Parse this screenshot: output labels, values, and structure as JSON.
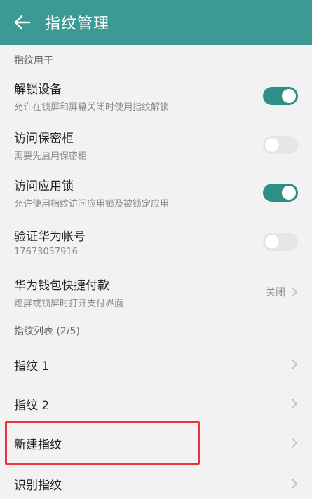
{
  "header": {
    "title": "指纹管理",
    "icon": "back-arrow-icon"
  },
  "sections": {
    "usage": "指纹用于",
    "list": "指纹列表 (2/5)"
  },
  "settings": [
    {
      "title": "解锁设备",
      "subtitle": "允许在锁屏和屏幕关闭时使用指纹解锁",
      "toggle": "on"
    },
    {
      "title": "访问保密柜",
      "subtitle": "需要先启用保密柜",
      "toggle": "off"
    },
    {
      "title": "访问应用锁",
      "subtitle": "允许使用指纹访问应用锁及被锁定应用",
      "toggle": "on"
    },
    {
      "title": "验证华为帐号",
      "subtitle": "17673057916",
      "toggle": "off"
    },
    {
      "title": "华为钱包快捷付款",
      "subtitle": "熄屏或锁屏时打开支付界面",
      "value": "关闭"
    }
  ],
  "fingerprints": [
    {
      "label": "指纹 1"
    },
    {
      "label": "指纹 2"
    },
    {
      "label": "新建指纹"
    },
    {
      "label": "识别指纹"
    }
  ],
  "colors": {
    "header": "#3b9a93",
    "toggle_on": "#2d8f86",
    "highlight": "#e8333a"
  }
}
